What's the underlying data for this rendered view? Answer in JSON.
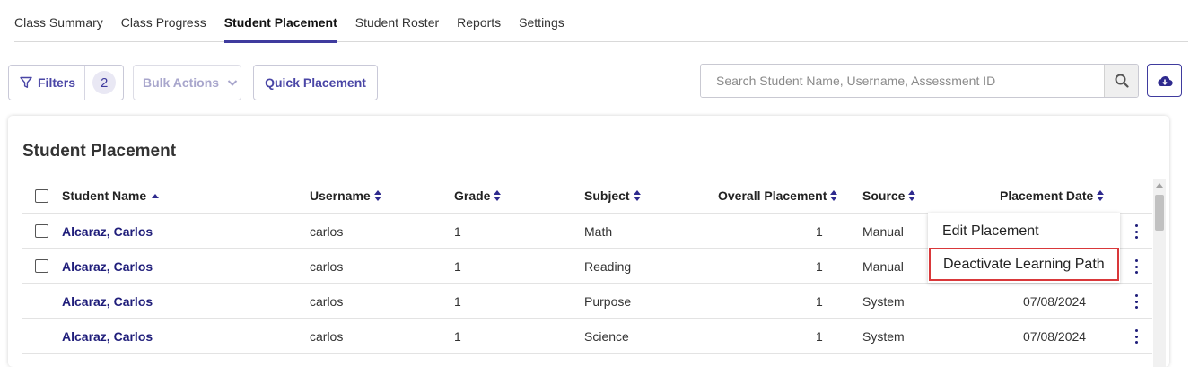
{
  "tabs": [
    "Class Summary",
    "Class Progress",
    "Student Placement",
    "Student Roster",
    "Reports",
    "Settings"
  ],
  "active_tab": "Student Placement",
  "toolbar": {
    "filters_label": "Filters",
    "filter_count": "2",
    "bulk_actions_label": "Bulk Actions",
    "quick_placement_label": "Quick Placement",
    "search_placeholder": "Search Student Name, Username, Assessment ID"
  },
  "card": {
    "title": "Student Placement"
  },
  "table": {
    "headers": {
      "student_name": "Student Name",
      "username": "Username",
      "grade": "Grade",
      "subject": "Subject",
      "overall_placement": "Overall Placement",
      "source": "Source",
      "placement_date": "Placement Date"
    },
    "rows": [
      {
        "name": "Alcaraz, Carlos",
        "username": "carlos",
        "grade": "1",
        "subject": "Math",
        "overall": "1",
        "source": "Manual",
        "date": "",
        "checkbox": true
      },
      {
        "name": "Alcaraz, Carlos",
        "username": "carlos",
        "grade": "1",
        "subject": "Reading",
        "overall": "1",
        "source": "Manual",
        "date": "",
        "checkbox": true
      },
      {
        "name": "Alcaraz, Carlos",
        "username": "carlos",
        "grade": "1",
        "subject": "Purpose",
        "overall": "1",
        "source": "System",
        "date": "07/08/2024",
        "checkbox": false
      },
      {
        "name": "Alcaraz, Carlos",
        "username": "carlos",
        "grade": "1",
        "subject": "Science",
        "overall": "1",
        "source": "System",
        "date": "07/08/2024",
        "checkbox": false
      }
    ]
  },
  "menu": {
    "items": [
      "Edit Placement",
      "Deactivate Learning Path"
    ],
    "highlighted": "Deactivate Learning Path"
  },
  "colors": {
    "accent": "#3f3b9e",
    "name_link": "#1f1d7a",
    "highlight_border": "#d9383a"
  }
}
